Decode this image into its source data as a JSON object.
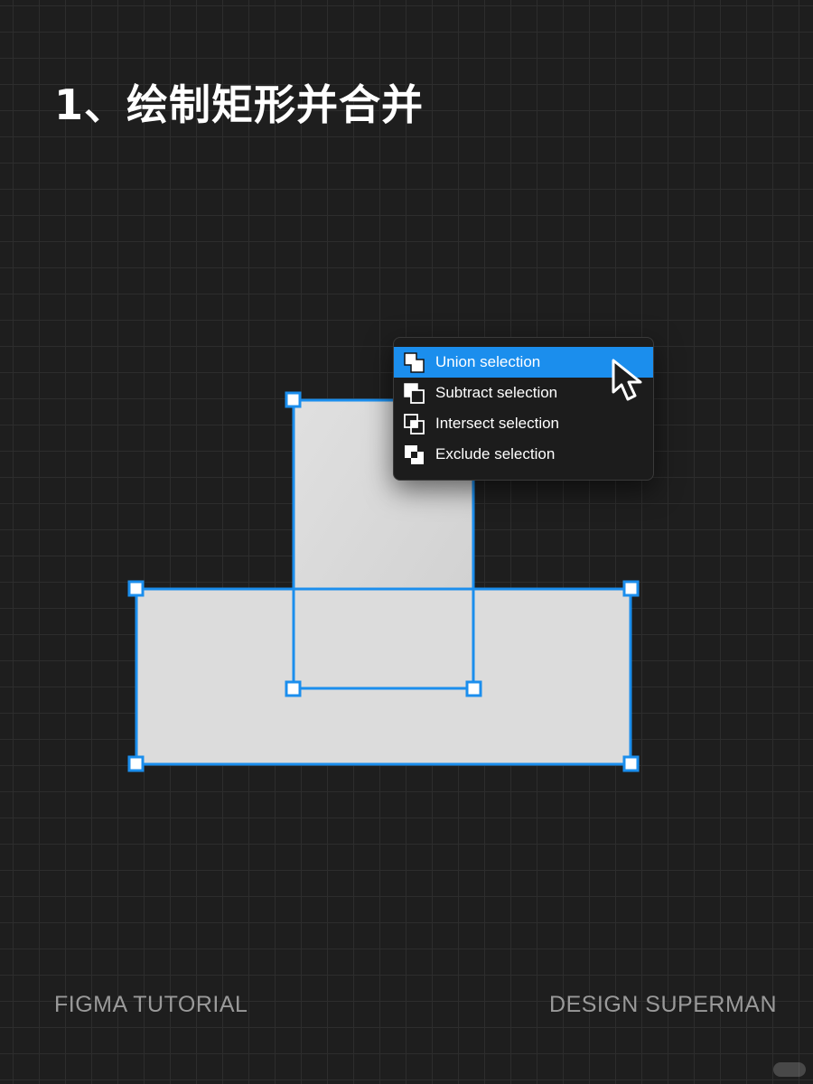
{
  "title": "1、绘制矩形并合并",
  "context_menu": {
    "items": [
      {
        "label": "Union selection",
        "icon": "union-icon",
        "active": true
      },
      {
        "label": "Subtract selection",
        "icon": "subtract-icon",
        "active": false
      },
      {
        "label": "Intersect selection",
        "icon": "intersect-icon",
        "active": false
      },
      {
        "label": "Exclude selection",
        "icon": "exclude-icon",
        "active": false
      }
    ]
  },
  "footer": {
    "left": "FIGMA TUTORIAL",
    "right": "DESIGN SUPERMAN"
  },
  "colors": {
    "background": "#1e1e1e",
    "grid": "#2d2d2d",
    "selection": "#1b8eed",
    "shape_fill": "#dcdcdc",
    "menu_bg": "#1c1c1c"
  }
}
